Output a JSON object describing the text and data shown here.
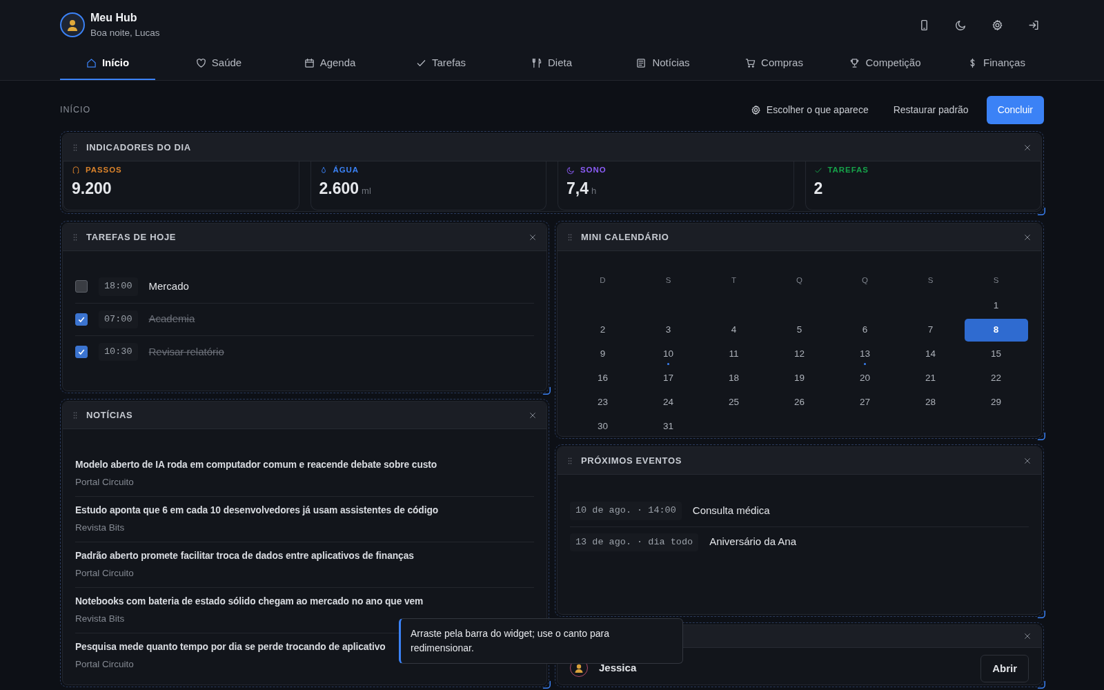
{
  "app": {
    "title": "Meu Hub",
    "greeting": "Boa noite, Lucas"
  },
  "nav": [
    {
      "label": "Início",
      "selected": true
    },
    {
      "label": "Saúde",
      "selected": false
    },
    {
      "label": "Agenda",
      "selected": false
    },
    {
      "label": "Tarefas",
      "selected": false
    },
    {
      "label": "Dieta",
      "selected": false
    },
    {
      "label": "Notícias",
      "selected": false
    },
    {
      "label": "Compras",
      "selected": false
    },
    {
      "label": "Competição",
      "selected": false
    },
    {
      "label": "Finanças",
      "selected": false
    }
  ],
  "toolbar": {
    "section": "INÍCIO",
    "choose": "Escolher o que aparece",
    "restore": "Restaurar padrão",
    "done": "Concluir"
  },
  "indicators": {
    "title": "INDICADORES DO DIA",
    "items": [
      {
        "label": "PASSOS",
        "value": "9.200",
        "color": "#d9822b"
      },
      {
        "label": "ÁGUA",
        "value": "2.600",
        "unit": "ml",
        "color": "#3b82f6"
      },
      {
        "label": "SONO",
        "value": "7,4",
        "unit": "h",
        "color": "#8b5cf6"
      },
      {
        "label": "TAREFAS",
        "value": "2",
        "color": "#16a34a"
      }
    ]
  },
  "tasks": {
    "title": "TAREFAS DE HOJE",
    "items": [
      {
        "time": "18:00",
        "title": "Mercado",
        "done": false
      },
      {
        "time": "07:00",
        "title": "Academia",
        "done": true
      },
      {
        "time": "10:30",
        "title": "Revisar relatório",
        "done": true
      }
    ]
  },
  "news": {
    "title": "NOTÍCIAS",
    "items": [
      {
        "title": "Modelo aberto de IA roda em computador comum e reacende debate sobre custo",
        "source": "Portal Circuito"
      },
      {
        "title": "Estudo aponta que 6 em cada 10 desenvolvedores já usam assistentes de código",
        "source": "Revista Bits"
      },
      {
        "title": "Padrão aberto promete facilitar troca de dados entre aplicativos de finanças",
        "source": "Portal Circuito"
      },
      {
        "title": "Notebooks com bateria de estado sólido chegam ao mercado no ano que vem",
        "source": "Revista Bits"
      },
      {
        "title": "Pesquisa mede quanto tempo por dia se perde trocando de aplicativo",
        "source": "Portal Circuito"
      }
    ]
  },
  "calendar": {
    "title": "MINI CALENDÁRIO",
    "weekdays": [
      "D",
      "S",
      "T",
      "Q",
      "Q",
      "S",
      "S"
    ],
    "weeks": [
      [
        {
          "kind": "empty"
        },
        {
          "kind": "empty"
        },
        {
          "kind": "empty"
        },
        {
          "kind": "empty"
        },
        {
          "kind": "empty"
        },
        {
          "kind": "empty"
        },
        {
          "kind": "day",
          "day": "1",
          "selected": false,
          "event": false
        }
      ],
      [
        {
          "day": "2",
          "selected": false,
          "event": false
        },
        {
          "day": "3",
          "selected": false,
          "event": false
        },
        {
          "day": "4",
          "selected": false,
          "event": false
        },
        {
          "day": "5",
          "selected": false,
          "event": false
        },
        {
          "day": "6",
          "selected": false,
          "event": false
        },
        {
          "day": "7",
          "selected": false,
          "event": false
        },
        {
          "day": "8",
          "selected": true,
          "event": false
        }
      ],
      [
        {
          "day": "9",
          "selected": false,
          "event": false
        },
        {
          "day": "10",
          "selected": false,
          "event": true
        },
        {
          "day": "11",
          "selected": false,
          "event": false
        },
        {
          "day": "12",
          "selected": false,
          "event": false
        },
        {
          "day": "13",
          "selected": false,
          "event": true
        },
        {
          "day": "14",
          "selected": false,
          "event": false
        },
        {
          "day": "15",
          "selected": false,
          "event": false
        }
      ],
      [
        {
          "day": "16",
          "selected": false,
          "event": false
        },
        {
          "day": "17",
          "selected": false,
          "event": false
        },
        {
          "day": "18",
          "selected": false,
          "event": false
        },
        {
          "day": "19",
          "selected": false,
          "event": false
        },
        {
          "day": "20",
          "selected": false,
          "event": false
        },
        {
          "day": "21",
          "selected": false,
          "event": false
        },
        {
          "day": "22",
          "selected": false,
          "event": false
        }
      ],
      [
        {
          "day": "23",
          "selected": false,
          "event": false
        },
        {
          "day": "24",
          "selected": false,
          "event": false
        },
        {
          "day": "25",
          "selected": false,
          "event": false
        },
        {
          "day": "26",
          "selected": false,
          "event": false
        },
        {
          "day": "27",
          "selected": false,
          "event": false
        },
        {
          "day": "28",
          "selected": false,
          "event": false
        },
        {
          "day": "29",
          "selected": false,
          "event": false
        }
      ],
      [
        {
          "day": "30",
          "selected": false,
          "event": false
        },
        {
          "day": "31",
          "selected": false,
          "event": false
        },
        {
          "kind": "empty"
        },
        {
          "kind": "empty"
        },
        {
          "kind": "empty"
        },
        {
          "kind": "empty"
        },
        {
          "kind": "empty"
        }
      ]
    ]
  },
  "events": {
    "title": "PRÓXIMOS EVENTOS",
    "items": [
      {
        "when": "10 de ago. · 14:00",
        "title": "Consulta médica"
      },
      {
        "when": "13 de ago. · dia todo",
        "title": "Aniversário da Ana"
      }
    ]
  },
  "contact": {
    "name": "Jessica",
    "action": "Abrir"
  },
  "tooltip": "Arraste pela barra do widget; use o canto para redimensionar."
}
